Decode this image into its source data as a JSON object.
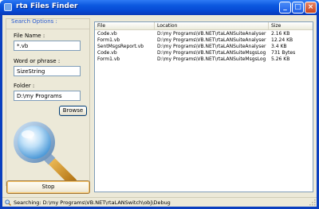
{
  "window": {
    "title": "rta Files Finder"
  },
  "search_options": {
    "group_title": "Search Options :",
    "file_name_label": "File Name :",
    "file_name_value": "*.vb",
    "word_label": "Word or phrase :",
    "word_value": "SizeString",
    "folder_label": "Folder :",
    "folder_value": "D:\\my Programs",
    "browse_label": "Browse"
  },
  "stop_label": "Stop",
  "results": {
    "columns": [
      "File",
      "Location",
      "Size"
    ],
    "rows": [
      {
        "file": "Code.vb",
        "location": "D:\\my Programs\\VB.NET\\rtaLANSuiteAnalyser",
        "size": "2.16 KB"
      },
      {
        "file": "Form1.vb",
        "location": "D:\\my Programs\\VB.NET\\rtaLANSuiteAnalyser",
        "size": "12.24 KB"
      },
      {
        "file": "SentMsgsReport.vb",
        "location": "D:\\my Programs\\VB.NET\\rtaLANSuiteAnalyser",
        "size": "3.4 KB"
      },
      {
        "file": "Code.vb",
        "location": "D:\\my Programs\\VB.NET\\rtaLANSuiteMsgsLog",
        "size": "731 Bytes"
      },
      {
        "file": "Form1.vb",
        "location": "D:\\my Programs\\VB.NET\\rtaLANSuiteMsgsLog",
        "size": "5.26 KB"
      }
    ]
  },
  "status": {
    "text": "Searching: D:\\my Programs\\VB.NET\\rtaLANSwitch\\obj\\Debug"
  },
  "colors": {
    "accent": "#2a5bd0",
    "titlebar": "#0d59e0",
    "panel": "#ece9d8"
  },
  "icons": [
    "app-icon",
    "minimize-icon",
    "maximize-icon",
    "close-icon",
    "magnifier-icon",
    "search-status-icon",
    "resize-grip-icon"
  ]
}
